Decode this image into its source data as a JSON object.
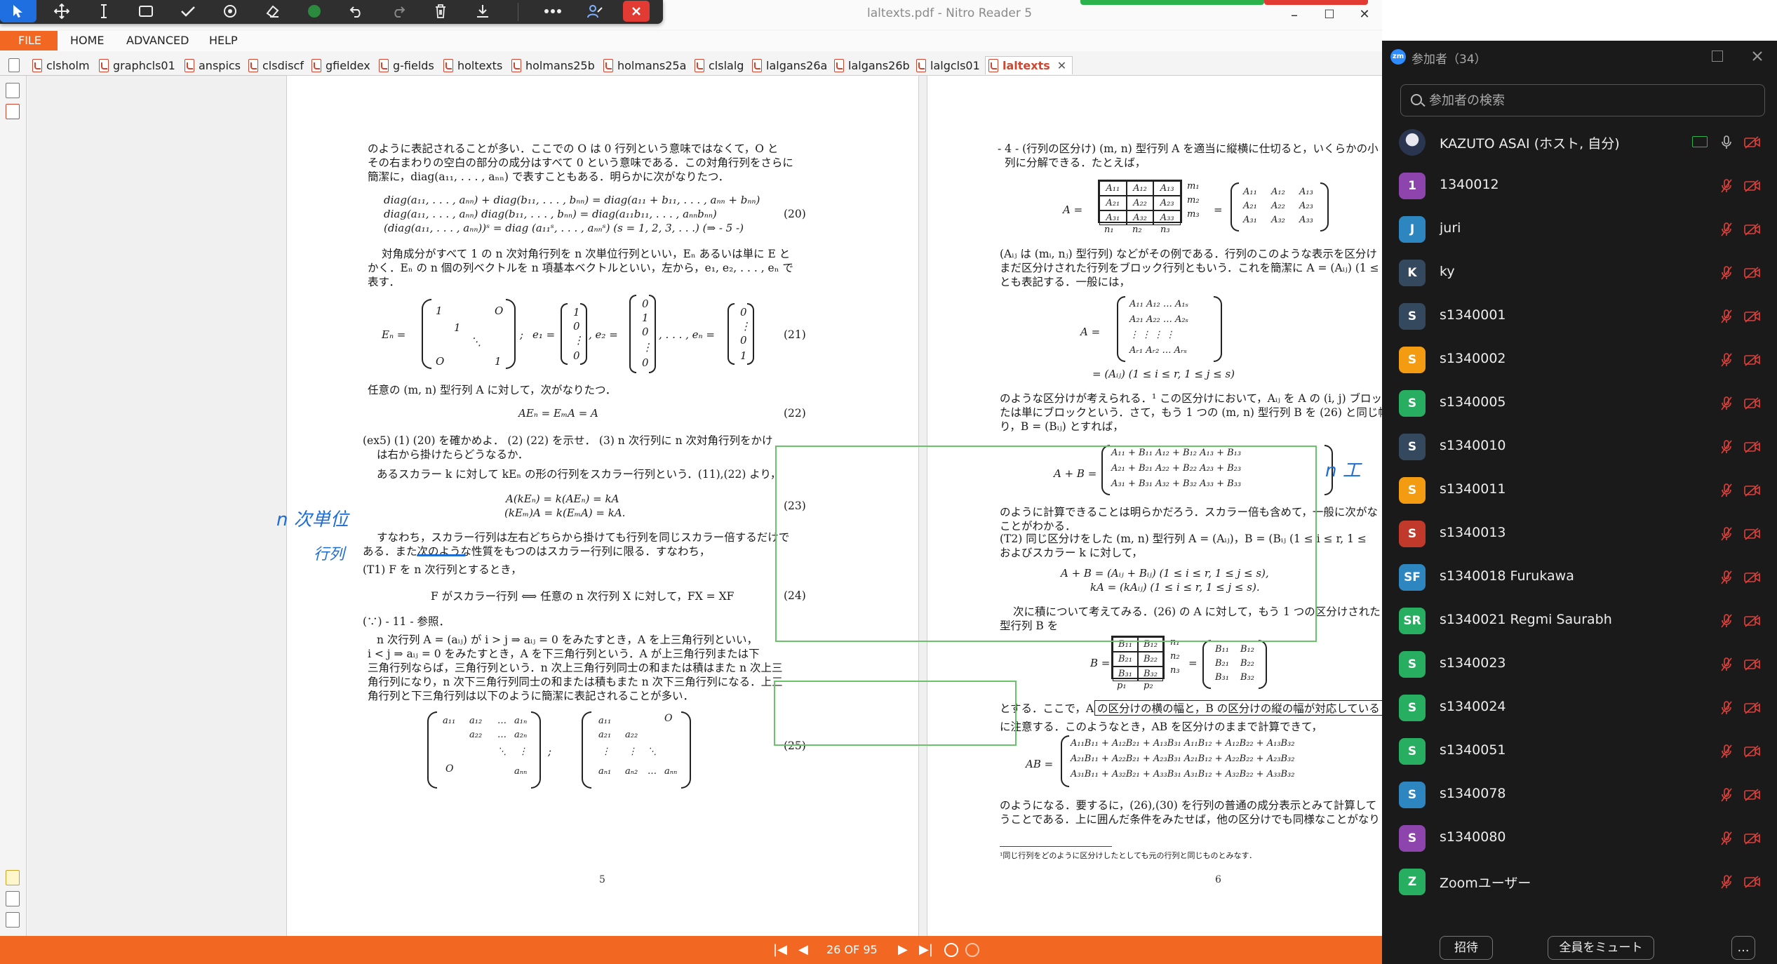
{
  "window": {
    "title": "laltexts.pdf - Nitro Reader 5",
    "minimize": "–",
    "maximize": "☐",
    "close": "✕"
  },
  "ribbon": {
    "file": "FILE",
    "home": "HOME",
    "advanced": "ADVANCED",
    "help": "HELP"
  },
  "doc_tabs": [
    "clsholm",
    "graphcls01",
    "anspics",
    "clsdiscf",
    "gfieldex",
    "g-fields",
    "holtexts",
    "holmans25b",
    "holmans25a",
    "clslalg",
    "lalgans26a",
    "lalgans26b",
    "lalgcls01",
    "laltexts"
  ],
  "doc_tab_close": "✕",
  "page5": {
    "lines": [
      "のように表記されることが多い．ここでの O は 0 行列という意味ではなくて，O と",
      "その右まわりの空白の部分の成分はすべて 0 という意味である．この対角行列をさらに",
      "簡潔に，diag(a₁₁, . . . , aₙₙ) で表すこともある．明らかに次がなりたつ．",
      "diag(a₁₁, . . . , aₙₙ) + diag(b₁₁, . . . , bₙₙ) = diag(a₁₁ + b₁₁, . . . , aₙₙ + bₙₙ)",
      "diag(a₁₁, . . . , aₙₙ) diag(b₁₁, . . . , bₙₙ) = diag(a₁₁b₁₁, . . . , aₙₙbₙₙ)",
      "(diag(a₁₁, . . . , aₙₙ))ˢ = diag (a₁₁ˢ, . . . , aₙₙˢ)    (s = 1, 2, 3, . . .)    (⇒ - 5 -)",
      "対角成分がすべて 1 の n 次対角行列を n 次単位行列といい，Eₙ あるいは単に E と",
      "かく．Eₙ の n 個の列ベクトルを n 項基本ベクトルといい，左から，e₁, e₂, . . . , eₙ で",
      "表す．",
      "任意の (m, n) 型行列 A に対して，次がなりたつ．",
      "AEₙ = EₘA = A",
      "(ex5) (1) (20) を確かめよ． (2) (22) を示せ． (3) n 次行列に n 次対角行列をかけ",
      "は右から掛けたらどうなるか．",
      "あるスカラー k に対して kEₙ の形の行列をスカラー行列という．(11),(22) より，",
      "A(kEₙ) = k(AEₙ) = kA",
      "(kEₘ)A = k(EₘA) = kA.",
      "すなわち，スカラー行列は左右どちらから掛けても行列を同じスカラー倍するだけで",
      "ある．また次のような性質をもつのはスカラー行列に限る．すなわち，",
      "(T1) F を n 次行列とするとき，",
      "F がスカラー行列 ⟺ 任意の n 次行列 X に対して，FX = XF",
      "(∵) - 11 - 参照．",
      "n 次行列 A = (aᵢⱼ) が i > j ⇒ aᵢⱼ = 0 をみたすとき，A を上三角行列といい，",
      "i < j ⇒ aᵢⱼ = 0 をみたすとき，A を下三角行列という．A が上三角行列または下",
      "三角行列ならば，三角行列という．n 次上三角行列同士の和または積はまた n 次上三",
      "角行列になり，n 次下三角行列同士の和または積もまた n 次下三角行列になる．上三",
      "角行列と下三角行列は以下のように簡潔に表記されることが多い．"
    ],
    "eqnos": [
      "(20)",
      "(21)",
      "(22)",
      "(23)",
      "(24)",
      "(25)"
    ],
    "En_label": "Eₙ =",
    "matrix_entries": [
      "1",
      "O",
      "1",
      "⋱",
      "O",
      "1"
    ],
    "basis_e1": "e₁ =",
    "basis_e2": ", e₂ =",
    "basis_en": ", . . . , eₙ =",
    "e1": [
      "1",
      "0",
      "⋮",
      "0"
    ],
    "e2": [
      "0",
      "1",
      "0",
      "⋮",
      "0"
    ],
    "en": [
      "0",
      "⋮",
      "0",
      "1"
    ],
    "upper": [
      "a₁₁",
      "a₁₂",
      "…",
      "a₁ₙ",
      "a₂₂",
      "…",
      "a₂ₙ",
      "⋱",
      "⋮",
      "O",
      "aₙₙ"
    ],
    "lower": [
      "a₁₁",
      "O",
      "a₂₁",
      "a₂₂",
      "⋮",
      "⋮",
      "⋱",
      "aₙ₁",
      "aₙ₂",
      "…",
      "aₙₙ"
    ],
    "page_number": "5"
  },
  "page6": {
    "lines": [
      "- 4 - (行列の区分け) (m, n) 型行列 A を適当に縦横に仕切ると，いくらかの小",
      "列に分解できる．たとえば，",
      "(Aᵢⱼ は (mᵢ, nⱼ) 型行列) などがその例である．行列のこのような表示を区分け",
      "まだ区分けされた行列をブロック行列ともいう．これを簡潔に A = (Aᵢⱼ) (1 ≤ i",
      "とも表記する．一般には，",
      "のような区分けが考えられる．¹ この区分けにおいて，Aᵢⱼ を A の (i, j) ブロッ",
      "たは単にブロックという．さて，もう 1 つの (m, n) 型行列 B を (26) と同じ幅",
      "り，B = (Bᵢⱼ) とすれば，",
      "のように計算できることは明らかだろう．スカラー倍も含めて，一般に次がな",
      "ことがわかる．",
      "(T2) 同じ区分けをした (m, n) 型行列 A = (Aᵢⱼ)，B = (Bᵢⱼ (1 ≤ i ≤ r, 1 ≤",
      "およびスカラー k に対して，",
      "A + B = (Aᵢⱼ + Bᵢⱼ)     (1 ≤ i ≤ r, 1 ≤ j ≤ s),",
      "kA = (kAᵢⱼ)     (1 ≤ i ≤ r, 1 ≤ j ≤ s).",
      "次に積について考えてみる．(26) の A に対して，もう 1 つの区分けされた",
      "型行列 B を",
      "とする．ここで，A の区分けの横の幅と，B の区分けの縦の幅が対応している",
      "に注意する．このようなとき，AB を区分けのままで計算できて，",
      "のようになる．要するに，(26),(30) を行列の普通の成分表示とみて計算して",
      "うことである．上に囲んだ条件をみたせば，他の区分けでも同様なことがなり"
    ],
    "footnote": "¹同じ行列をどのように区分けしたとしても元の行列と同じものとみなす．",
    "A_block_label": "A =",
    "A_block": [
      "A₁₁",
      "A₁₂",
      "A₁₃",
      "A₂₁",
      "A₂₂",
      "A₂₃",
      "A₃₁",
      "A₃₂",
      "A₃₃"
    ],
    "A_general_rows": [
      "A₁₁  A₁₂  …  A₁ₛ",
      "A₂₁  A₂₂  …  A₂ₛ",
      "⋮    ⋮    ⋮    ⋮",
      "Aᵣ₁  Aᵣ₂  …  Aᵣₛ"
    ],
    "A_general_label": "A =",
    "A_general_tail": "= (Aᵢⱼ)   (1 ≤ i ≤ r, 1 ≤ j ≤ s)",
    "m_labels": [
      "m₁",
      "m₂",
      "m₃"
    ],
    "n_labels": [
      "n₁",
      "n₂",
      "n₃"
    ],
    "sum_label": "A + B =",
    "sum_rows": [
      "A₁₁ + B₁₁   A₁₂ + B₁₂   A₁₃ + B₁₃",
      "A₂₁ + B₂₁   A₂₂ + B₂₂   A₂₃ + B₂₃",
      "A₃₁ + B₃₁   A₃₂ + B₃₂   A₃₃ + B₃₃"
    ],
    "B_block_label": "B =",
    "B_block": [
      "B₁₁",
      "B₁₂",
      "B₂₁",
      "B₂₂",
      "B₃₁",
      "B₃₂"
    ],
    "p_labels": [
      "p₁",
      "p₂"
    ],
    "AB_label": "AB =",
    "AB_rows": [
      "A₁₁B₁₁ + A₁₂B₂₁ + A₁₃B₃₁   A₁₁B₁₂ + A₁₂B₂₂ + A₁₃B₃₂",
      "A₂₁B₁₁ + A₂₂B₂₁ + A₂₃B₃₁   A₂₁B₁₂ + A₂₂B₂₂ + A₂₃B₃₂",
      "A₃₁B₁₁ + A₃₂B₂₁ + A₃₃B₃₁   A₃₁B₁₂ + A₃₂B₂₂ + A₃₃B₃₂"
    ],
    "page_number": "6"
  },
  "ink": {
    "note1": "n 次単位",
    "note2": "行列",
    "note3": "n 工"
  },
  "statusbar": {
    "page_indicator": "26 OF 95",
    "first": "|◀",
    "prev": "◀",
    "next": "▶",
    "last": "▶|"
  },
  "zoom": {
    "title": "参加者（34）",
    "search_placeholder": "参加者の検索",
    "participants": [
      {
        "initials": "",
        "name": "KAZUTO ASAI (ホスト, 自分)",
        "color": "#3a5f8a"
      },
      {
        "initials": "1",
        "name": "1340012",
        "color": "#8e44ad"
      },
      {
        "initials": "J",
        "name": "juri",
        "color": "#2e86c1"
      },
      {
        "initials": "K",
        "name": "ky",
        "color": "#34495e"
      },
      {
        "initials": "S",
        "name": "s1340001",
        "color": "#34495e"
      },
      {
        "initials": "S",
        "name": "s1340002",
        "color": "#f39c12"
      },
      {
        "initials": "S",
        "name": "s1340005",
        "color": "#27ae60"
      },
      {
        "initials": "S",
        "name": "s1340010",
        "color": "#34495e"
      },
      {
        "initials": "S",
        "name": "s1340011",
        "color": "#f39c12"
      },
      {
        "initials": "S",
        "name": "s1340013",
        "color": "#c0392b"
      },
      {
        "initials": "SF",
        "name": "s1340018 Furukawa",
        "color": "#2e86c1"
      },
      {
        "initials": "SR",
        "name": "s1340021 Regmi Saurabh",
        "color": "#27ae60"
      },
      {
        "initials": "S",
        "name": "s1340023",
        "color": "#27ae60"
      },
      {
        "initials": "S",
        "name": "s1340024",
        "color": "#27ae60"
      },
      {
        "initials": "S",
        "name": "s1340051",
        "color": "#27ae60"
      },
      {
        "initials": "S",
        "name": "s1340078",
        "color": "#2e86c1"
      },
      {
        "initials": "S",
        "name": "s1340080",
        "color": "#8e44ad"
      },
      {
        "initials": "Z",
        "name": "Zoomユーザー",
        "color": "#27ae60"
      }
    ],
    "invite": "招待",
    "mute_all": "全員をミュート",
    "more": "…"
  },
  "colors": {
    "nitro_orange": "#f26722",
    "annotation_green": "#6cc26a",
    "ink_blue": "#1e6cd6",
    "zoom_bg": "#1a1a1a",
    "mic_off_red": "#e0403a"
  }
}
